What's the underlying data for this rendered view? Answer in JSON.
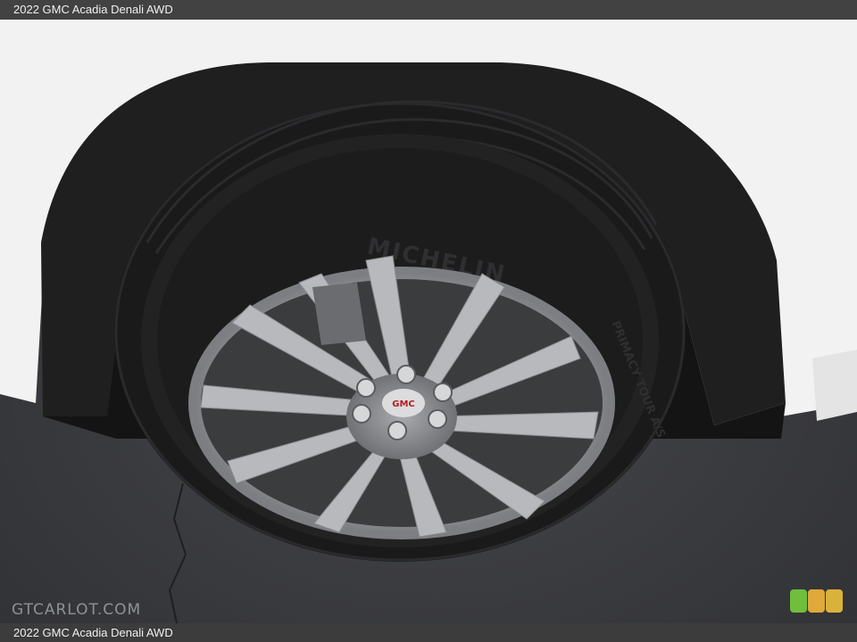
{
  "header": {
    "title": "2022 GMC Acadia Denali AWD"
  },
  "footer": {
    "caption": "2022 GMC Acadia Denali AWD"
  },
  "watermark": {
    "text": "GTCARLOT.COM"
  },
  "photo": {
    "tire_brand": "MICHELIN",
    "tire_model": "PRIMACY TOUR A/S",
    "center_cap": "GMC"
  },
  "color_swatches": [
    "#6fbf3c",
    "#e0a93a",
    "#d9b23a"
  ]
}
